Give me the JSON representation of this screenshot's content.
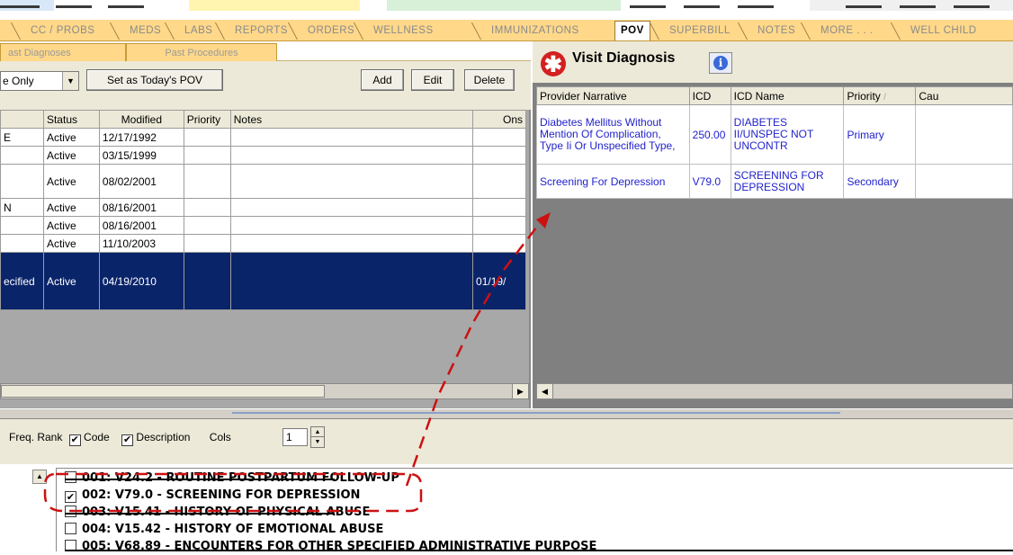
{
  "top_tabs": [
    {
      "label": "CC / PROBS",
      "active": false
    },
    {
      "label": "MEDS",
      "active": false
    },
    {
      "label": "LABS",
      "active": false
    },
    {
      "label": "REPORTS",
      "active": false
    },
    {
      "label": "ORDERS",
      "active": false
    },
    {
      "label": "WELLNESS",
      "active": false
    },
    {
      "label": "IMMUNIZATIONS",
      "active": false
    },
    {
      "label": "POV",
      "active": true
    },
    {
      "label": "SUPERBILL",
      "active": false
    },
    {
      "label": "NOTES",
      "active": false
    },
    {
      "label": "MORE . . .",
      "active": false
    },
    {
      "label": "WELL CHILD",
      "active": false
    }
  ],
  "left": {
    "subtabs": [
      "ast Diagnoses",
      "Past Procedures"
    ],
    "filter_value": "e Only",
    "set_todays_pov": "Set as Today's POV",
    "add": "Add",
    "edit": "Edit",
    "delete": "Delete",
    "columns": [
      "",
      "Status",
      "Modified",
      "Priority",
      "Notes",
      "Ons"
    ],
    "rows": [
      {
        "c0": "E",
        "status": "Active",
        "modified": "12/17/1992",
        "priority": "",
        "notes": "",
        "onset": ""
      },
      {
        "c0": "",
        "status": "Active",
        "modified": "03/15/1999",
        "priority": "",
        "notes": "",
        "onset": ""
      },
      {
        "c0": "",
        "status": "Active",
        "modified": "08/02/2001",
        "priority": "",
        "notes": "",
        "onset": ""
      },
      {
        "c0": "N",
        "status": "Active",
        "modified": "08/16/2001",
        "priority": "",
        "notes": "",
        "onset": ""
      },
      {
        "c0": "",
        "status": "Active",
        "modified": "08/16/2001",
        "priority": "",
        "notes": "",
        "onset": ""
      },
      {
        "c0": "",
        "status": "Active",
        "modified": "11/10/2003",
        "priority": "",
        "notes": "",
        "onset": ""
      },
      {
        "c0": "ecified",
        "status": "Active",
        "modified": "04/19/2010",
        "priority": "",
        "notes": "",
        "onset": "01/19/"
      }
    ]
  },
  "visit": {
    "title": "Visit Diagnosis",
    "info_icon": "i",
    "columns": [
      "Provider Narrative",
      "ICD",
      "ICD Name",
      "Priority",
      "Cau"
    ],
    "rows": [
      {
        "narrative": "Diabetes Mellitus Without Mention Of Complication, Type Ii Or Unspecified Type,",
        "icd": "250.00",
        "icd_name": "DIABETES II/UNSPEC NOT UNCONTR",
        "priority": "Primary"
      },
      {
        "narrative": "Screening For Depression",
        "icd": "V79.0",
        "icd_name": "SCREENING FOR DEPRESSION",
        "priority": "Secondary"
      }
    ]
  },
  "freq": {
    "freq_rank": "Freq. Rank",
    "code": "Code",
    "description": "Description",
    "cols_label": "Cols",
    "cols_value": "1"
  },
  "list_items": [
    {
      "text": "001: V24.2 - ROUTINE POSTPARTUM FOLLOW-UP",
      "checked": false
    },
    {
      "text": "002: V79.0 - SCREENING FOR DEPRESSION",
      "checked": true
    },
    {
      "text": "003: V15.41 - HISTORY OF PHYSICAL ABUSE",
      "checked": false
    },
    {
      "text": "004: V15.42 - HISTORY OF EMOTIONAL ABUSE",
      "checked": false
    },
    {
      "text": "005: V68.89 - ENCOUNTERS FOR OTHER SPECIFIED ADMINISTRATIVE PURPOSE",
      "checked": false
    }
  ],
  "colors": {
    "tab_bar": "#ffd88a",
    "selection": "#0a246a",
    "link_text": "#2222cc",
    "annotation": "#cc1111"
  }
}
